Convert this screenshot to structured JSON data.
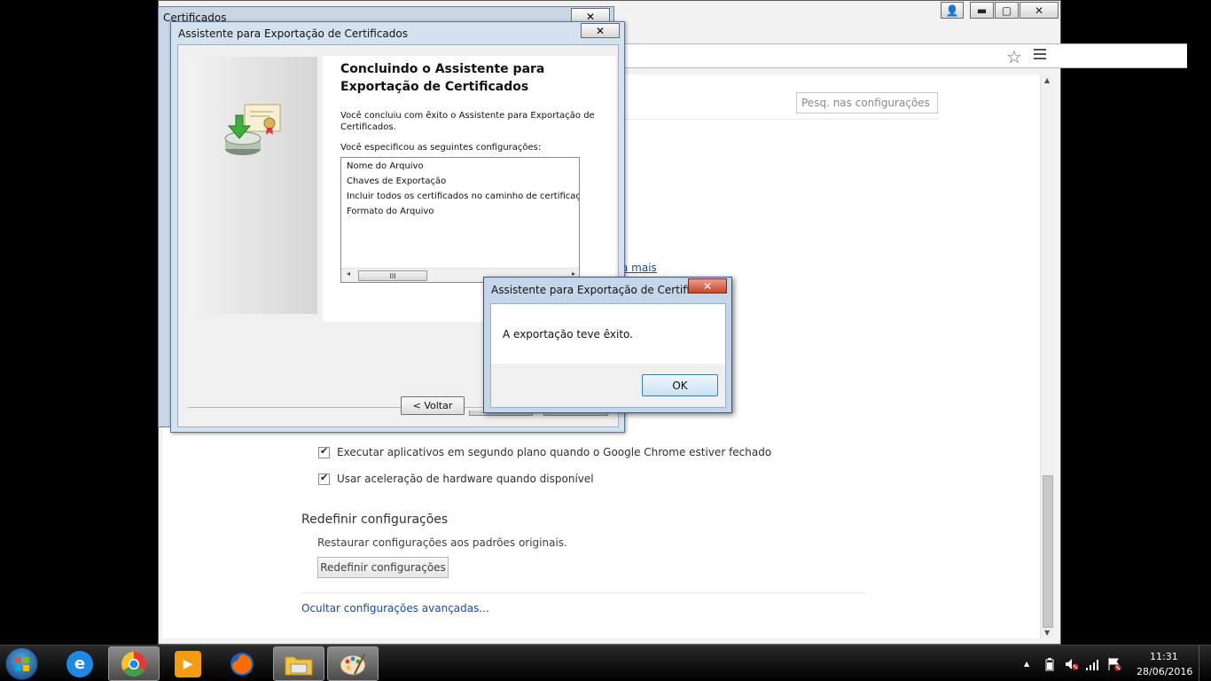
{
  "certificates_window": {
    "title": "Certificados",
    "close_glyph": "✕"
  },
  "chrome": {
    "window_controls": {
      "user_glyph": "👤",
      "minimize_glyph": "▬",
      "maximize_glyph": "▢",
      "close_glyph": "✕"
    },
    "star_glyph": "☆",
    "settings": {
      "search_placeholder": "Pesq. nas configurações",
      "learn_more_link": "a mais",
      "checkboxes": [
        {
          "label": "Executar aplicativos em segundo plano quando o Google Chrome estiver fechado",
          "checked": true
        },
        {
          "label": "Usar aceleração de hardware quando disponível",
          "checked": true
        }
      ],
      "reset_section": {
        "title": "Redefinir configurações",
        "description": "Restaurar configurações aos padrões originais.",
        "button_label": "Redefinir configurações"
      },
      "hide_advanced_link": "Ocultar configurações avançadas..."
    }
  },
  "wizard": {
    "title": "Assistente para Exportação de Certificados",
    "close_glyph": "✕",
    "heading": "Concluindo o Assistente para Exportação de Certificados",
    "description": "Você concluiu com êxito o Assistente para Exportação de Certificados.",
    "settings_label": "Você especificou as seguintes configurações:",
    "settings_list": [
      "Nome do Arquivo",
      "Chaves de Exportação",
      "Incluir todos os certificados no caminho de certificação",
      "Formato do Arquivo"
    ],
    "scroll_left_glyph": "◂",
    "scroll_right_glyph": "▸",
    "scroll_thumb_glyph": "III",
    "back_button_label": "< Voltar"
  },
  "success_dialog": {
    "title": "Assistente para Exportação de Certifica...",
    "close_glyph": "✕",
    "message": "A exportação teve êxito.",
    "ok_label": "OK"
  },
  "taskbar": {
    "apps": [
      {
        "name": "internet-explorer",
        "letter": "e",
        "color": "#1e88e5",
        "active": false
      },
      {
        "name": "google-chrome",
        "letter": "",
        "color": "#e53935",
        "active": true
      },
      {
        "name": "media-player",
        "letter": "▶",
        "color": "#f39c12",
        "active": false
      },
      {
        "name": "firefox",
        "letter": "",
        "color": "#ff6d00",
        "active": false
      },
      {
        "name": "file-explorer",
        "letter": "",
        "color": "#f4c542",
        "active": true
      },
      {
        "name": "paint",
        "letter": "",
        "color": "#9b59b6",
        "active": true
      }
    ],
    "tray": {
      "show_hidden_glyph": "▲",
      "clock_time": "11:31",
      "clock_date": "28/06/2016"
    }
  },
  "colors": {
    "link": "#1a4ab0",
    "dialog_close": "#c8452c",
    "ok_border": "#3c7fb1"
  }
}
